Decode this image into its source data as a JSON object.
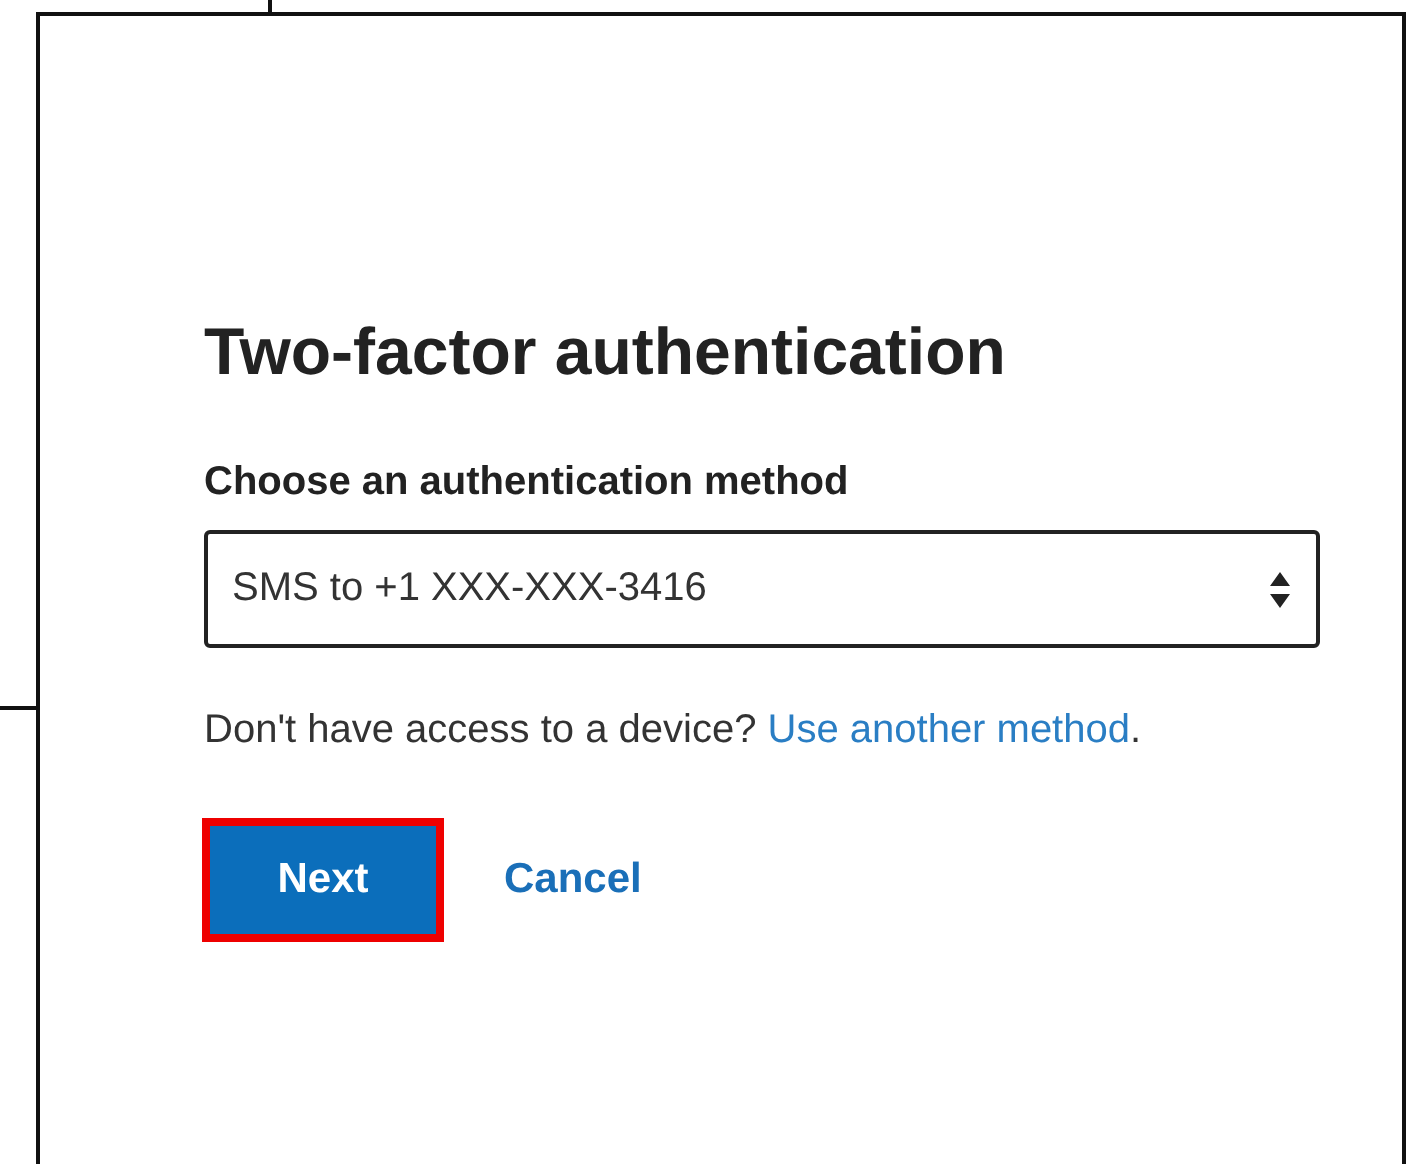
{
  "dialog": {
    "title": "Two-factor authentication",
    "method_label": "Choose an authentication method",
    "method_value": "SMS to +1 XXX-XXX-3416",
    "help_text": "Don't have access to a device?",
    "help_link": "Use another method",
    "help_end": ".",
    "buttons": [
      {
        "label": "Next",
        "kind": "primary",
        "highlighted": true
      },
      {
        "label": "Cancel",
        "kind": "link",
        "highlighted": false
      }
    ]
  }
}
